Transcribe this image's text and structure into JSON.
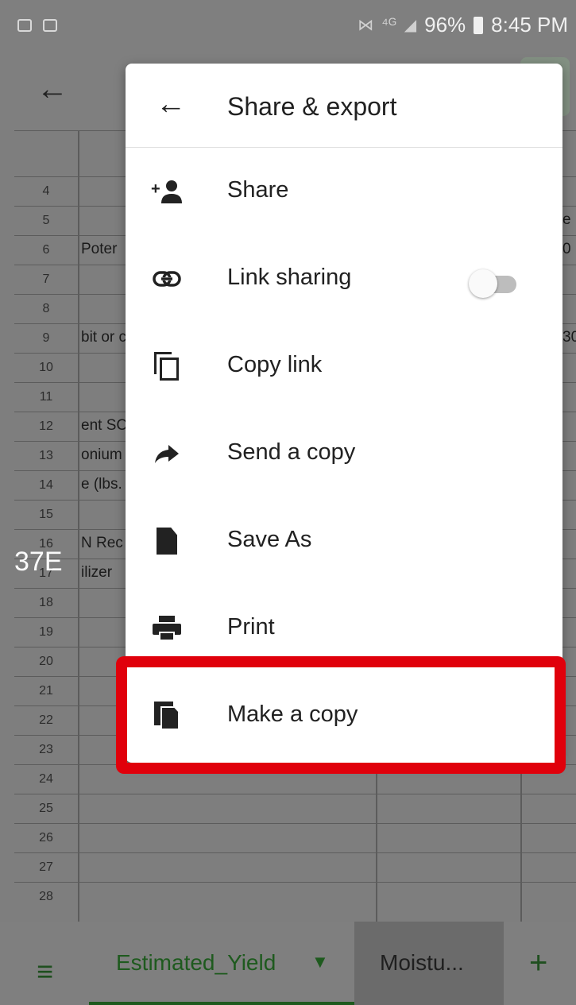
{
  "status_bar": {
    "battery": "96%",
    "time": "8:45 PM"
  },
  "sheet": {
    "row_numbers": [
      "4",
      "5",
      "6",
      "7",
      "8",
      "9",
      "10",
      "11",
      "12",
      "13",
      "14",
      "15",
      "16",
      "17",
      "18",
      "19",
      "20",
      "21",
      "22",
      "23",
      "24",
      "25",
      "26",
      "27",
      "28"
    ],
    "cells": {
      "r6": "Poter",
      "r9": "bit or c",
      "r12": "ent SC",
      "r13": "onium",
      "r14": "e (lbs.",
      "r16": "N Rec",
      "r17": "ilizer"
    },
    "right_cells": {
      "r5": "e",
      "r6": "0",
      "r9": "30"
    },
    "stray_text": "37E"
  },
  "menu": {
    "title": "Share & export",
    "items": [
      {
        "icon": "add-person-icon",
        "label": "Share"
      },
      {
        "icon": "link-icon",
        "label": "Link sharing",
        "toggle": false
      },
      {
        "icon": "copy-link-icon",
        "label": "Copy link"
      },
      {
        "icon": "send-icon",
        "label": "Send a copy"
      },
      {
        "icon": "document-icon",
        "label": "Save As"
      },
      {
        "icon": "print-icon",
        "label": "Print"
      },
      {
        "icon": "make-copy-icon",
        "label": "Make a copy"
      }
    ]
  },
  "tabs": {
    "active": "Estimated_Yield",
    "active_caret": "▼",
    "other": "Moistu...",
    "add": "+"
  },
  "colors": {
    "highlight": "#e0000b",
    "active_tab": "#1e5a1e"
  }
}
